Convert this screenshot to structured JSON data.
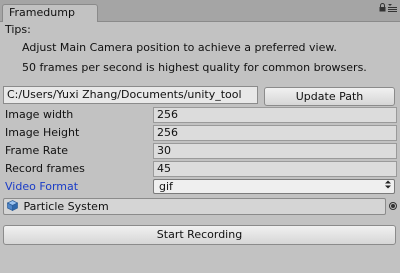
{
  "tab": {
    "title": "Framedump"
  },
  "header_icons": {
    "lock": "lock-icon",
    "menu": "kebab-menu-icon"
  },
  "tips": {
    "title": "Tips:",
    "lines": [
      "Adjust Main Camera position to achieve a preferred view.",
      "50 frames per second is highest quality for common browsers."
    ]
  },
  "path": {
    "value": "C:/Users/Yuxi Zhang/Documents/unity_tool",
    "button_label": "Update Path"
  },
  "properties": [
    {
      "label": "Image width",
      "value": "256"
    },
    {
      "label": "Image Height",
      "value": "256"
    },
    {
      "label": "Frame Rate",
      "value": "30"
    },
    {
      "label": "Record frames",
      "value": "45"
    }
  ],
  "video_format": {
    "label": "Video Format",
    "selected": "gif",
    "label_color": "#1a3cc7"
  },
  "object_field": {
    "value": "Particle System",
    "icon": "cube-icon"
  },
  "start_button": {
    "label": "Start Recording"
  }
}
